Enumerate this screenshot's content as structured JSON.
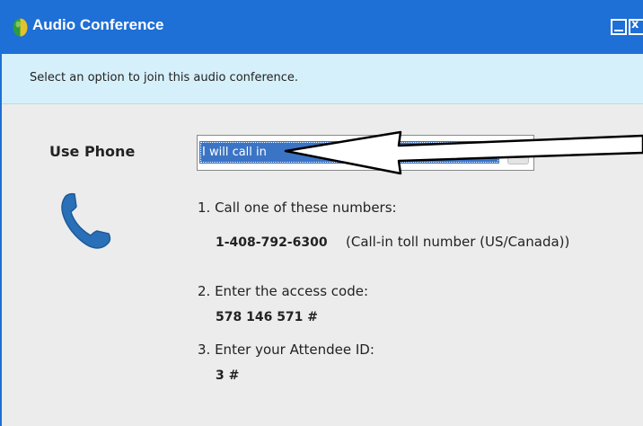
{
  "window": {
    "title": "Audio Conference",
    "close_glyph": "x"
  },
  "banner": {
    "instruction": "Select an option to join this audio conference."
  },
  "join": {
    "method_label": "Use Phone",
    "dropdown_selected": "I will call in"
  },
  "steps": {
    "step1": "1. Call one of these numbers:",
    "phone_number": "1-408-792-6300",
    "phone_description": "(Call-in toll number (US/Canada))",
    "step2": "2. Enter the access code:",
    "access_code": "578 146 571 #",
    "step3": "3. Enter your Attendee ID:",
    "attendee_id": "3 #"
  },
  "colors": {
    "titlebar": "#1e6fd6",
    "banner": "#d6f0fb",
    "selection": "#3b74c4",
    "phone_icon": "#2a70b8"
  },
  "icons": [
    "app-globe-icon",
    "minimize-icon",
    "close-icon",
    "phone-icon",
    "chevron-down-icon",
    "annotation-arrow"
  ]
}
